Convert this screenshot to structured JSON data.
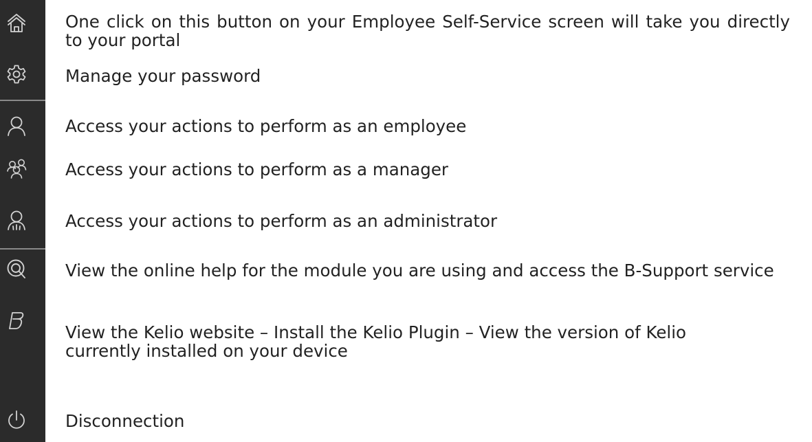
{
  "rows": [
    {
      "icon": "home-icon",
      "text": "One click on this button on your Employee Self-Service screen will take you directly to your portal"
    },
    {
      "icon": "gear-icon",
      "text": "Manage your password"
    },
    {
      "icon": "employee-user-icon",
      "text": "Access your actions to perform as an employee"
    },
    {
      "icon": "manager-users-icon",
      "text": "Access your actions to perform as a manager"
    },
    {
      "icon": "administrator-user-icon",
      "text": "Access your actions to perform as an administrator"
    },
    {
      "icon": "help-magnifier-icon",
      "text": "View the online help for the module you are using and access the B-Support service"
    },
    {
      "icon": "kelio-logo-icon",
      "text": "View the Kelio website – Install the Kelio Plugin – View the version of Kelio currently installed on your device"
    },
    {
      "icon": "power-icon",
      "text": "Disconnection"
    }
  ],
  "colors": {
    "rail_background": "#2b2b2b",
    "icon": "#d2d2d2",
    "divider": "#8a8a8a",
    "text": "#222222"
  }
}
